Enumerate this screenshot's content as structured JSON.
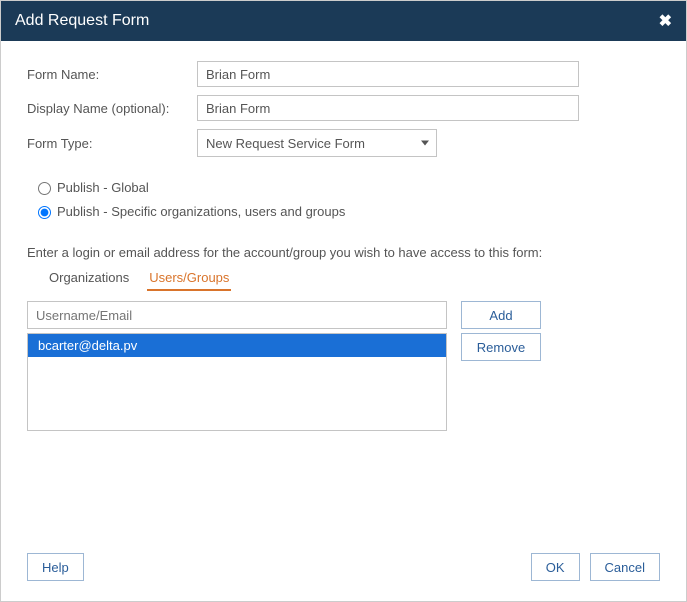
{
  "title": "Add Request Form",
  "labels": {
    "formName": "Form Name:",
    "displayName": "Display Name (optional):",
    "formType": "Form Type:"
  },
  "fields": {
    "formName": "Brian Form",
    "displayName": "Brian Form",
    "formType": "New Request Service Form"
  },
  "radios": {
    "global": "Publish - Global",
    "specific": "Publish - Specific organizations, users and groups"
  },
  "instruction": "Enter a login or email address for the account/group you wish to have access to this form:",
  "tabs": {
    "orgs": "Organizations",
    "users": "Users/Groups"
  },
  "search": {
    "placeholder": "Username/Email"
  },
  "listItems": [
    "bcarter@delta.pv"
  ],
  "buttons": {
    "add": "Add",
    "remove": "Remove",
    "help": "Help",
    "ok": "OK",
    "cancel": "Cancel"
  }
}
